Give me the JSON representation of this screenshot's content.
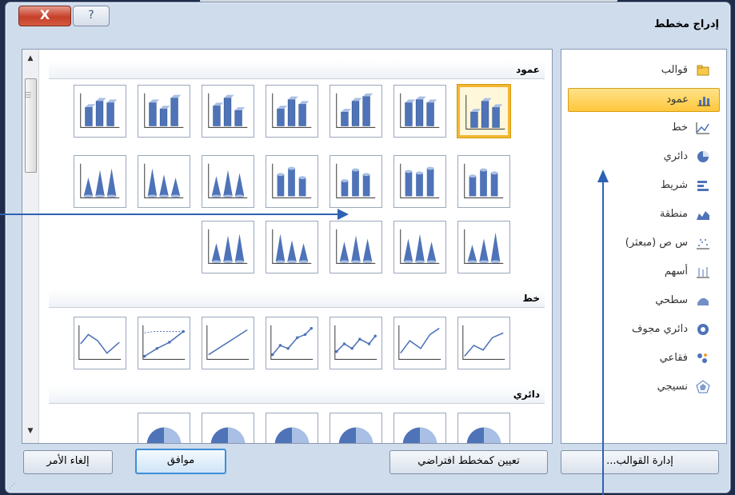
{
  "dialog": {
    "title": "إدراج مخطط",
    "close_label": "X",
    "help_label": "?"
  },
  "categories": [
    {
      "label": "قوالب",
      "icon": "folder-icon"
    },
    {
      "label": "عمود",
      "icon": "column-chart-icon",
      "selected": true
    },
    {
      "label": "خط",
      "icon": "line-chart-icon"
    },
    {
      "label": "دائري",
      "icon": "pie-chart-icon"
    },
    {
      "label": "شريط",
      "icon": "bar-chart-icon"
    },
    {
      "label": "منطقة",
      "icon": "area-chart-icon"
    },
    {
      "label": "س ص (مبعثر)",
      "icon": "scatter-chart-icon"
    },
    {
      "label": "أسهم",
      "icon": "stock-chart-icon"
    },
    {
      "label": "سطحي",
      "icon": "surface-chart-icon"
    },
    {
      "label": "دائري مجوف",
      "icon": "doughnut-chart-icon"
    },
    {
      "label": "فقاعي",
      "icon": "bubble-chart-icon"
    },
    {
      "label": "نسيجي",
      "icon": "radar-chart-icon"
    }
  ],
  "groups": {
    "column": {
      "label": "عمود"
    },
    "line": {
      "label": "خط"
    },
    "pie": {
      "label": "دائري"
    }
  },
  "buttons": {
    "manage_templates": "إدارة القوالب...",
    "set_default": "تعيين كمخطط افتراضي",
    "ok": "موافق",
    "cancel": "إلغاء الأمر"
  },
  "colors": {
    "accent": "#f2b735",
    "chart_blue": "#4e73b8",
    "arrow": "#2f61b3"
  }
}
